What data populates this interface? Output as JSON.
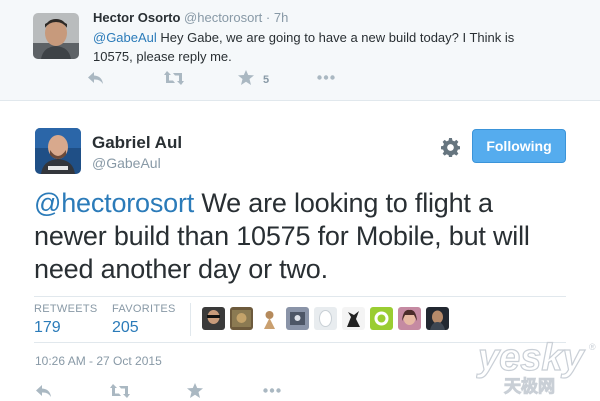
{
  "parent_tweet": {
    "name": "Hector Osorto",
    "handle": "@hectorosort",
    "separator": "·",
    "time": "7h",
    "mention": "@GabeAul",
    "text_line1": " Hey Gabe, we are going to have a new build today? I Think is",
    "text_line2": "10575, please reply me.",
    "favorite_count": "5"
  },
  "main_tweet": {
    "name": "Gabriel Aul",
    "handle": "@GabeAul",
    "follow_label": "Following",
    "mention": "@hectorosort",
    "text_line1_rest": " We are looking to flight a",
    "text_line2": "newer build than 10575 for Mobile, but will",
    "text_line3": "need another day or two.",
    "retweets_label": "RETWEETS",
    "retweets_value": "179",
    "favorites_label": "FAVORITES",
    "favorites_value": "205",
    "timestamp": "10:26 AM - 27 Oct 2015"
  },
  "icons": [
    "reply-icon",
    "retweet-icon",
    "favorite-icon",
    "more-icon",
    "gear-icon"
  ],
  "colors": {
    "link": "#2b7bb9",
    "follow_button": "#55acee",
    "muted": "#8899a6",
    "icon": "#aab8c2",
    "parent_background": "#f5f8fa"
  },
  "watermark": {
    "logo_text": "yesky",
    "sub_text": "天极网",
    "registered": "®"
  }
}
